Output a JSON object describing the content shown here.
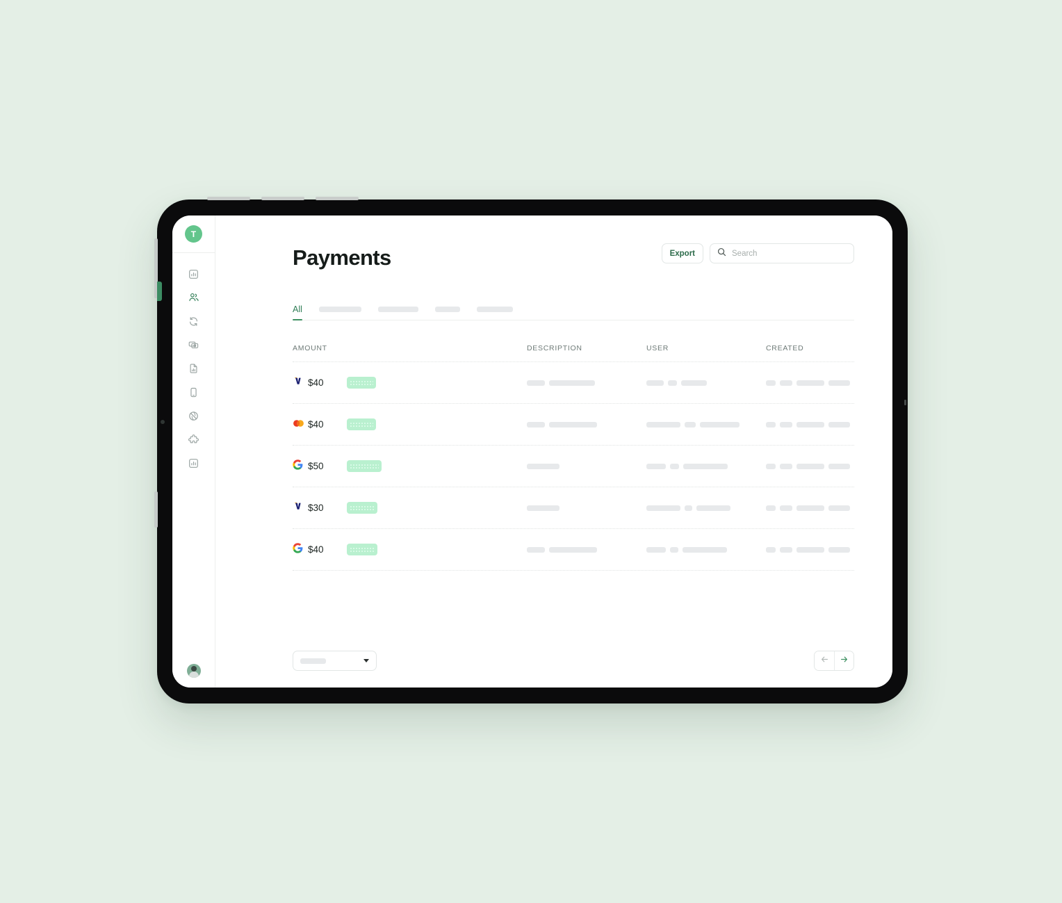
{
  "background_color": "#e4efe6",
  "app": {
    "brand_initial": "T",
    "brand_color": "#63c58c"
  },
  "sidebar": {
    "items": [
      {
        "icon": "chart-bar-box-icon",
        "active": false
      },
      {
        "icon": "users-icon",
        "active": true
      },
      {
        "icon": "refresh-cycle-icon",
        "active": false
      },
      {
        "icon": "money-camera-icon",
        "active": false
      },
      {
        "icon": "file-chart-icon",
        "active": false
      },
      {
        "icon": "mobile-device-icon",
        "active": false
      },
      {
        "icon": "globe-slash-icon",
        "active": false
      },
      {
        "icon": "puzzle-piece-icon",
        "active": false
      },
      {
        "icon": "analytics-box-icon",
        "active": false
      }
    ],
    "avatar_label": "user-avatar"
  },
  "header": {
    "title": "Payments",
    "export_label": "Export",
    "search_placeholder": "Search",
    "search_value": "",
    "search_icon": "search-icon"
  },
  "tabs": [
    {
      "label": "All",
      "active": true,
      "skeleton_width": 0
    },
    {
      "label": "",
      "active": false,
      "skeleton_width": 61
    },
    {
      "label": "",
      "active": false,
      "skeleton_width": 58
    },
    {
      "label": "",
      "active": false,
      "skeleton_width": 36
    },
    {
      "label": "",
      "active": false,
      "skeleton_width": 52
    }
  ],
  "table": {
    "columns": [
      "AMOUNT",
      "DESCRIPTION",
      "USER",
      "CREATED"
    ],
    "rows": [
      {
        "card_brand": "visa",
        "amount": "$40",
        "status_pill_width": 42,
        "description_skeletons": [
          26,
          66
        ],
        "user_skeletons": [
          25,
          13,
          37
        ],
        "created_skeletons": [
          14,
          18,
          40,
          31
        ]
      },
      {
        "card_brand": "mastercard",
        "amount": "$40",
        "status_pill_width": 42,
        "description_skeletons": [
          26,
          69
        ],
        "user_skeletons": [
          49,
          16,
          57
        ],
        "created_skeletons": [
          14,
          18,
          40,
          31
        ]
      },
      {
        "card_brand": "google",
        "amount": "$50",
        "status_pill_width": 50,
        "description_skeletons": [
          47
        ],
        "user_skeletons": [
          28,
          13,
          64
        ],
        "created_skeletons": [
          14,
          18,
          40,
          31
        ]
      },
      {
        "card_brand": "visa",
        "amount": "$30",
        "status_pill_width": 44,
        "description_skeletons": [
          47
        ],
        "user_skeletons": [
          49,
          11,
          49
        ],
        "created_skeletons": [
          14,
          18,
          40,
          31
        ]
      },
      {
        "card_brand": "google",
        "amount": "$40",
        "status_pill_width": 44,
        "description_skeletons": [
          26,
          69
        ],
        "user_skeletons": [
          28,
          12,
          64
        ],
        "created_skeletons": [
          14,
          18,
          40,
          31
        ]
      }
    ]
  },
  "footer": {
    "rows_per_page_skeleton_width": 37,
    "rows_per_page_value": "",
    "caret_icon": "chevron-down-icon",
    "prev_icon": "arrow-left-icon",
    "next_icon": "arrow-right-icon",
    "prev_enabled": false,
    "next_enabled": true
  }
}
